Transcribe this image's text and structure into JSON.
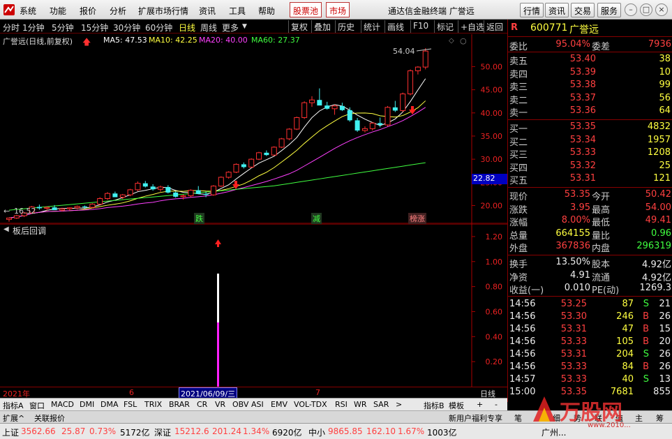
{
  "menu": {
    "items": [
      "系统",
      "功能",
      "报价",
      "分析",
      "扩展市场行情",
      "资讯",
      "工具",
      "帮助"
    ],
    "red_items": [
      "股票池",
      "市场"
    ],
    "title": "通达信金融终端  广誉远",
    "right_buttons": [
      "行情",
      "资讯",
      "交易",
      "服务"
    ]
  },
  "periods": {
    "items": [
      "分时",
      "1分钟",
      "5分钟",
      "15分钟",
      "30分钟",
      "60分钟",
      "日线",
      "周线",
      "更多"
    ],
    "active": "日线",
    "tools": [
      "复权",
      "叠加",
      "历史",
      "统计",
      "画线",
      "F10",
      "标记",
      "+自选",
      "返回"
    ]
  },
  "chart_data": {
    "type": "candlestick",
    "title": "广誉远(日线,前复权)",
    "ma_legend": [
      {
        "name": "MA5: 47.53",
        "color": "#ffffff"
      },
      {
        "name": "MA10: 42.25",
        "color": "#ffff40"
      },
      {
        "name": "MA20: 40.00",
        "color": "#ff40ff"
      },
      {
        "name": "MA60: 27.37",
        "color": "#40ff40"
      }
    ],
    "yticks": [
      "50.00",
      "45.00",
      "40.00",
      "35.00",
      "30.00",
      "25.00",
      "20.00"
    ],
    "ylim": [
      16,
      57
    ],
    "current_price_marker": "22.82",
    "high_label": "54.04",
    "low_label": "16.52",
    "events": [
      "跌",
      "减",
      "榜涨"
    ],
    "candles": [
      [
        17.0,
        17.4,
        16.5,
        17.3
      ],
      [
        17.3,
        18.0,
        17.1,
        17.8
      ],
      [
        17.8,
        18.6,
        17.5,
        18.4
      ],
      [
        18.4,
        19.9,
        18.2,
        19.7
      ],
      [
        19.7,
        20.2,
        19.1,
        19.4
      ],
      [
        19.4,
        19.8,
        18.9,
        19.6
      ],
      [
        19.6,
        20.1,
        19.2,
        19.0
      ],
      [
        19.0,
        19.5,
        18.7,
        19.3
      ],
      [
        19.3,
        19.6,
        18.9,
        19.5
      ],
      [
        19.5,
        20.0,
        19.2,
        19.8
      ],
      [
        19.8,
        20.0,
        19.3,
        19.6
      ],
      [
        19.6,
        20.5,
        19.4,
        20.3
      ],
      [
        20.3,
        21.8,
        20.1,
        21.5
      ],
      [
        21.5,
        22.9,
        21.2,
        22.6
      ],
      [
        22.6,
        23.0,
        21.9,
        21.8
      ],
      [
        21.8,
        22.5,
        21.4,
        22.3
      ],
      [
        22.3,
        23.6,
        22.0,
        23.4
      ],
      [
        23.4,
        25.2,
        23.1,
        24.8
      ],
      [
        24.8,
        25.3,
        23.9,
        24.1
      ],
      [
        24.1,
        24.6,
        23.2,
        23.5
      ],
      [
        23.5,
        24.3,
        23.0,
        24.0
      ],
      [
        24.0,
        24.4,
        22.6,
        22.8
      ],
      [
        22.8,
        23.1,
        21.7,
        21.9
      ],
      [
        21.9,
        22.4,
        21.3,
        22.1
      ],
      [
        22.1,
        23.5,
        21.8,
        23.3
      ],
      [
        23.3,
        24.2,
        22.7,
        22.5
      ],
      [
        22.5,
        23.0,
        21.8,
        22.3
      ],
      [
        22.3,
        24.4,
        22.1,
        24.2
      ],
      [
        24.2,
        26.3,
        24.0,
        26.1
      ],
      [
        26.1,
        27.4,
        25.8,
        27.2
      ],
      [
        27.2,
        29.1,
        27.0,
        28.9
      ],
      [
        28.9,
        29.3,
        28.0,
        28.3
      ],
      [
        28.3,
        30.2,
        28.1,
        30.0
      ],
      [
        30.0,
        31.6,
        29.8,
        31.4
      ],
      [
        31.4,
        31.9,
        30.7,
        30.9
      ],
      [
        30.9,
        32.8,
        30.7,
        32.6
      ],
      [
        32.6,
        34.6,
        32.4,
        34.4
      ],
      [
        34.4,
        36.7,
        34.1,
        36.5
      ],
      [
        36.5,
        39.2,
        36.3,
        39.0
      ],
      [
        39.0,
        42.5,
        38.7,
        42.2
      ],
      [
        42.2,
        43.6,
        41.3,
        42.8
      ],
      [
        42.8,
        45.3,
        42.4,
        41.6
      ],
      [
        41.6,
        42.4,
        40.7,
        40.9
      ],
      [
        40.9,
        41.8,
        39.6,
        41.5
      ],
      [
        41.5,
        42.2,
        40.4,
        40.6
      ],
      [
        40.6,
        41.2,
        38.1,
        38.4
      ],
      [
        38.4,
        38.9,
        35.9,
        36.2
      ],
      [
        36.2,
        37.1,
        35.8,
        36.6
      ],
      [
        36.6,
        38.0,
        36.2,
        37.8
      ],
      [
        37.8,
        39.0,
        36.9,
        37.4
      ],
      [
        37.4,
        41.5,
        37.1,
        41.2
      ],
      [
        41.2,
        42.6,
        40.2,
        40.5
      ],
      [
        40.5,
        44.4,
        40.2,
        44.1
      ],
      [
        44.1,
        49.4,
        43.8,
        49.1
      ],
      [
        49.1,
        50.1,
        48.3,
        49.9
      ],
      [
        49.9,
        54.0,
        49.4,
        53.35
      ]
    ],
    "indicator_title": "板后回调",
    "indicator_yticks": [
      "1.20",
      "1.00",
      "0.80",
      "0.60",
      "0.40",
      "0.20"
    ],
    "indicator_ylim": [
      0,
      1.3
    ],
    "xlabels": [
      "2021年",
      "6",
      "2021/06/09/三",
      "7",
      "日线"
    ]
  },
  "quote": {
    "code": "600771",
    "name": "广誉远",
    "wei_bi_label": "委比",
    "wei_bi": "95.04%",
    "wei_cha_label": "委差",
    "wei_cha": "7936",
    "asks": [
      {
        "label": "卖五",
        "price": "53.40",
        "vol": "38"
      },
      {
        "label": "卖四",
        "price": "53.39",
        "vol": "10"
      },
      {
        "label": "卖三",
        "price": "53.38",
        "vol": "99"
      },
      {
        "label": "卖二",
        "price": "53.37",
        "vol": "56"
      },
      {
        "label": "卖一",
        "price": "53.36",
        "vol": "64"
      }
    ],
    "bids": [
      {
        "label": "买一",
        "price": "53.35",
        "vol": "4832"
      },
      {
        "label": "买二",
        "price": "53.34",
        "vol": "1957"
      },
      {
        "label": "买三",
        "price": "53.33",
        "vol": "1208"
      },
      {
        "label": "买四",
        "price": "53.32",
        "vol": "25"
      },
      {
        "label": "买五",
        "price": "53.31",
        "vol": "121"
      }
    ],
    "stats": [
      {
        "l1": "现价",
        "v1": "53.35",
        "c1": "red",
        "l2": "今开",
        "v2": "50.42",
        "c2": "red"
      },
      {
        "l1": "涨跌",
        "v1": "3.95",
        "c1": "red",
        "l2": "最高",
        "v2": "54.00",
        "c2": "red"
      },
      {
        "l1": "涨幅",
        "v1": "8.00%",
        "c1": "red",
        "l2": "最低",
        "v2": "49.41",
        "c2": "red"
      },
      {
        "l1": "总量",
        "v1": "664155",
        "c1": "yel",
        "l2": "量比",
        "v2": "0.96",
        "c2": "grn"
      },
      {
        "l1": "外盘",
        "v1": "367836",
        "c1": "red",
        "l2": "内盘",
        "v2": "296319",
        "c2": "grn"
      }
    ],
    "fin": [
      {
        "l1": "换手",
        "v1": "13.50%",
        "l2": "股本",
        "v2": "4.92亿"
      },
      {
        "l1": "净资",
        "v1": "4.91",
        "l2": "流通",
        "v2": "4.92亿"
      },
      {
        "l1": "收益(一)",
        "v1": "0.010",
        "l2": "PE(动)",
        "v2": "1269.3"
      }
    ],
    "ticks": [
      {
        "t": "14:56",
        "p": "53.25",
        "v": "87",
        "d": "S",
        "n": "21"
      },
      {
        "t": "14:56",
        "p": "53.30",
        "v": "246",
        "d": "B",
        "n": "26"
      },
      {
        "t": "14:56",
        "p": "53.31",
        "v": "47",
        "d": "B",
        "n": "15"
      },
      {
        "t": "14:56",
        "p": "53.33",
        "v": "105",
        "d": "B",
        "n": "20"
      },
      {
        "t": "14:56",
        "p": "53.31",
        "v": "204",
        "d": "S",
        "n": "26"
      },
      {
        "t": "14:56",
        "p": "53.33",
        "v": "84",
        "d": "B",
        "n": "26"
      },
      {
        "t": "14:57",
        "p": "53.33",
        "v": "40",
        "d": "S",
        "n": "13"
      },
      {
        "t": "15:00",
        "p": "53.35",
        "v": "7681",
        "d": "",
        "n": "855"
      }
    ]
  },
  "tabs": [
    "指标A",
    "窗口",
    "MACD",
    "DMI",
    "DMA",
    "FSL",
    "TRIX",
    "BRAR",
    "CR",
    "VR",
    "OBV",
    "ASI",
    "EMV",
    "VOL-TDX",
    "RSI",
    "WR",
    "SAR",
    ">",
    "指标B",
    "模板",
    "+",
    "-"
  ],
  "subtabs": [
    "扩展^",
    "关联报价",
    "新用户福利专享",
    "笔",
    "细",
    "势",
    "联",
    "值",
    "主",
    "筹"
  ],
  "status": {
    "sh_label": "上证",
    "sh_val": "3562.66",
    "sh_chg": "25.87",
    "sh_pct": "0.73%",
    "sh_amt": "5172亿",
    "sz_label": "深证",
    "sz_val": "15212.6",
    "sz_chg": "201.24",
    "sz_pct": "1.34%",
    "sz_amt": "6920亿",
    "zx_label": "中小",
    "zx_val": "9865.85",
    "zx_chg": "162.10",
    "zx_pct": "1.67%",
    "zx_amt": "1003亿",
    "region": "广州..."
  },
  "watermark": "万股网",
  "watermark_url": "www.2010..."
}
